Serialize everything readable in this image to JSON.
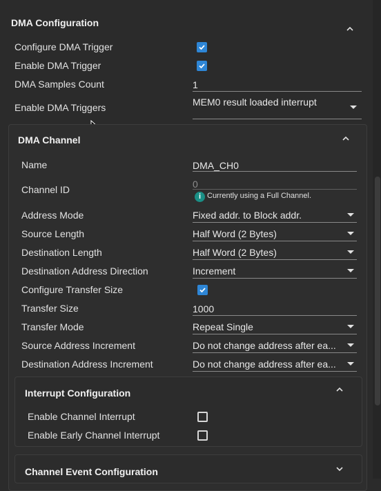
{
  "dma_config": {
    "title": "DMA Configuration",
    "configure_trigger_label": "Configure DMA Trigger",
    "configure_trigger_checked": true,
    "enable_trigger_label": "Enable DMA Trigger",
    "enable_trigger_checked": true,
    "samples_count_label": "DMA Samples Count",
    "samples_count_value": "1",
    "triggers_label": "Enable DMA Triggers",
    "triggers_value": "MEM0 result loaded interrupt"
  },
  "dma_channel": {
    "title": "DMA Channel",
    "rows": [
      {
        "label": "Name",
        "value": "DMA_CH0"
      },
      {
        "label": "Channel ID",
        "value": "0",
        "note": "Currently using a Full Channel."
      },
      {
        "label": "Address Mode",
        "value": "Fixed addr. to Block addr."
      },
      {
        "label": "Source Length",
        "value": "Half Word (2 Bytes)"
      },
      {
        "label": "Destination Length",
        "value": "Half Word (2 Bytes)"
      },
      {
        "label": "Destination Address Direction",
        "value": "Increment"
      },
      {
        "label": "Configure Transfer Size",
        "checked": true
      },
      {
        "label": "Transfer Size",
        "value": "1000"
      },
      {
        "label": "Transfer Mode",
        "value": "Repeat Single"
      },
      {
        "label": "Source Address Increment",
        "value": "Do not change address after ea..."
      },
      {
        "label": "Destination Address Increment",
        "value": "Do not change address after ea..."
      }
    ]
  },
  "interrupt_config": {
    "title": "Interrupt Configuration",
    "channel_interrupt_label": "Enable Channel Interrupt",
    "channel_interrupt_checked": false,
    "early_interrupt_label": "Enable Early Channel Interrupt",
    "early_interrupt_checked": false
  },
  "channel_event_config": {
    "title": "Channel Event Configuration"
  },
  "colors": {
    "background": "#2b2b2b",
    "checkbox_accent": "#2e86d6",
    "info_icon": "#1a8f86"
  }
}
